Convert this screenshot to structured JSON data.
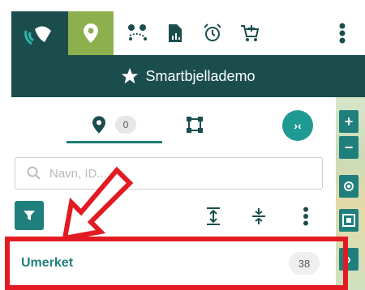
{
  "toolbar": {
    "logo_icon": "satellite-signal-logo-icon",
    "tools": [
      {
        "name": "location-pin-icon",
        "active": true
      },
      {
        "name": "route-icon",
        "active": false
      },
      {
        "name": "report-icon",
        "active": false
      },
      {
        "name": "alarm-clock-icon",
        "active": false
      },
      {
        "name": "add-cart-icon",
        "active": false
      },
      {
        "name": "more-vertical-icon",
        "active": false
      }
    ]
  },
  "title_bar": {
    "title": "Smartbjellademo",
    "icon": "star-icon"
  },
  "panel": {
    "tabs": [
      {
        "name": "tab-locations",
        "icon": "location-pin-icon",
        "count": "0",
        "active": true
      },
      {
        "name": "tab-areas",
        "icon": "polygon-area-icon",
        "active": false
      }
    ],
    "collapse_label": "›‹",
    "search": {
      "placeholder": "Navn, ID...",
      "value": ""
    },
    "actions": [
      "filter-icon",
      "expand-vertical-icon",
      "collapse-vertical-icon",
      "more-vertical-icon"
    ],
    "list": [
      {
        "label": "Umerket",
        "count": "38"
      }
    ]
  },
  "map_controls": [
    "zoom-in-button",
    "zoom-out-button",
    "locate-button",
    "layers-button",
    "expand-button"
  ],
  "colors": {
    "primary_dark": "#1b4d4d",
    "accent_green": "#8db04f",
    "teal": "#1f7f7c",
    "annotation_red": "#e21b22"
  }
}
